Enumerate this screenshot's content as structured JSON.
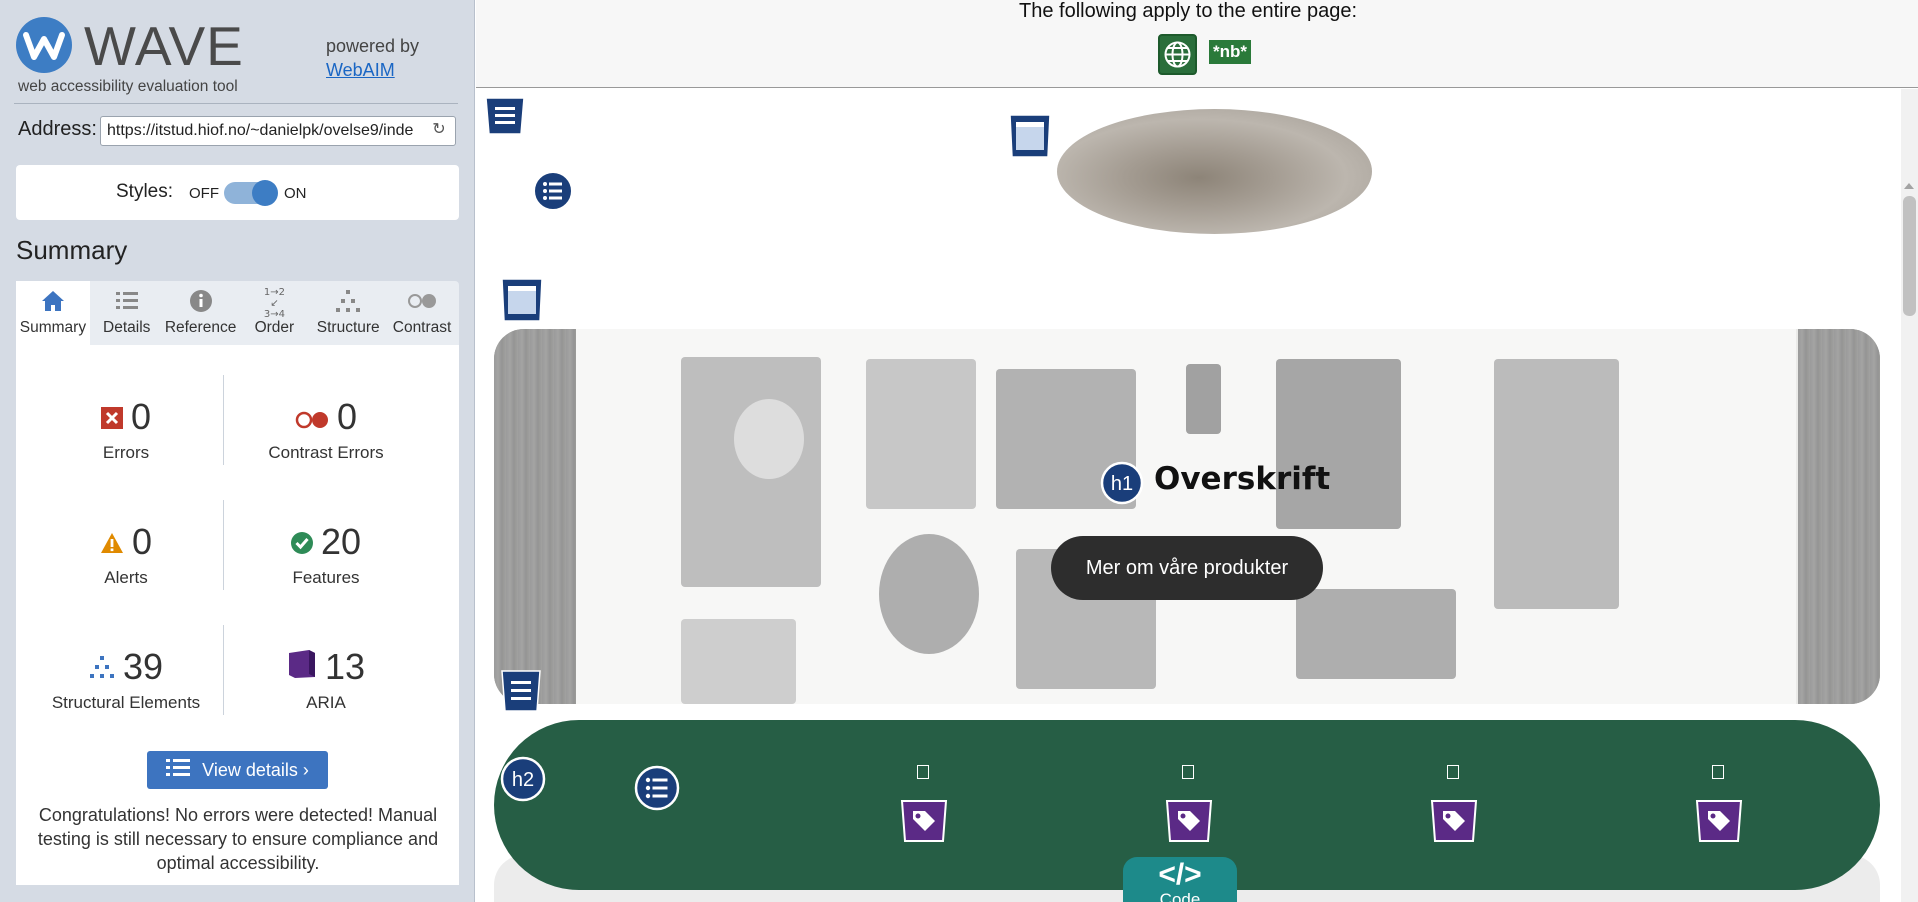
{
  "sidebar": {
    "title": "WAVE",
    "subtitle": "web accessibility evaluation tool",
    "powered_by": "powered by",
    "powered_link": "WebAIM",
    "address_label": "Address:",
    "address_value": "https://itstud.hiof.no/~danielpk/ovelse9/inde",
    "styles_label": "Styles:",
    "styles_off": "OFF",
    "styles_on": "ON",
    "summary_heading": "Summary",
    "tabs": [
      {
        "label": "Summary",
        "icon": "home-icon"
      },
      {
        "label": "Details",
        "icon": "list-icon"
      },
      {
        "label": "Reference",
        "icon": "info-icon"
      },
      {
        "label": "Order",
        "icon": "order-icon"
      },
      {
        "label": "Structure",
        "icon": "structure-icon"
      },
      {
        "label": "Contrast",
        "icon": "contrast-icon"
      }
    ],
    "stats": {
      "errors": {
        "value": "0",
        "label": "Errors"
      },
      "contrast_errors": {
        "value": "0",
        "label": "Contrast Errors"
      },
      "alerts": {
        "value": "0",
        "label": "Alerts"
      },
      "features": {
        "value": "20",
        "label": "Features"
      },
      "structural": {
        "value": "39",
        "label": "Structural Elements"
      },
      "aria": {
        "value": "13",
        "label": "ARIA"
      }
    },
    "view_details": "View details ›",
    "congrats": "Congratulations! No errors were detected! Manual testing is still necessary to ensure compliance and optimal accessibility."
  },
  "main": {
    "topbar_text": "The following apply to the entire page:",
    "lang_badge": "*nb*",
    "h1_badge": "h1",
    "h1_text": "Overskrift",
    "hero_button": "Mer om våre produkter",
    "h2_badge": "h2",
    "code_tab_symbol": "</>",
    "code_tab_label": "Code"
  },
  "colors": {
    "wave_blue": "#3d7dc4",
    "green_section": "#265e45",
    "error_red": "#c0392b",
    "feature_green": "#2e8b57",
    "alert_orange": "#e08a00",
    "aria_purple": "#5b2a86"
  }
}
